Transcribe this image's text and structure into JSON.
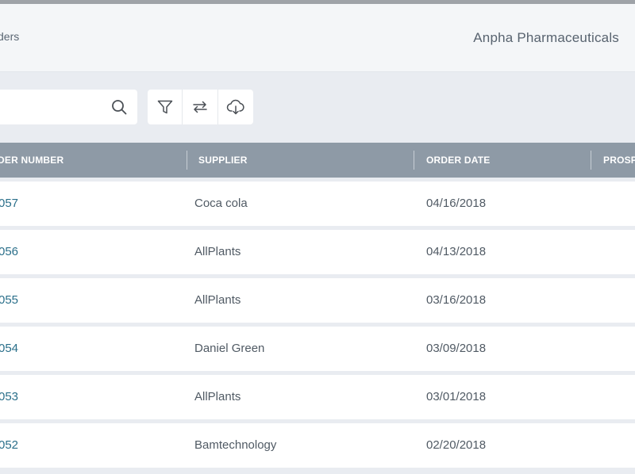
{
  "header": {
    "breadcrumb": "ders",
    "company": "Anpha Pharmaceuticals"
  },
  "search": {
    "value": "",
    "placeholder": ""
  },
  "toolbar": {
    "icons": [
      "filter-icon",
      "swap-icon",
      "cloud-download-icon"
    ]
  },
  "table": {
    "columns": [
      "DER NUMBER",
      "SUPPLIER",
      "ORDER DATE",
      "PROSP"
    ],
    "rows": [
      {
        "order_number": "057",
        "supplier": "Coca cola",
        "order_date": "04/16/2018"
      },
      {
        "order_number": "056",
        "supplier": "AllPlants",
        "order_date": "04/13/2018"
      },
      {
        "order_number": "055",
        "supplier": "AllPlants",
        "order_date": "03/16/2018"
      },
      {
        "order_number": "054",
        "supplier": "Daniel Green",
        "order_date": "03/09/2018"
      },
      {
        "order_number": "053",
        "supplier": "AllPlants",
        "order_date": "03/01/2018"
      },
      {
        "order_number": "052",
        "supplier": "Bamtechnology",
        "order_date": "02/20/2018"
      }
    ]
  },
  "colors": {
    "header_bg": "#8e9aa6",
    "link": "#2a6f8a",
    "page_bg": "#e9ecf1"
  }
}
